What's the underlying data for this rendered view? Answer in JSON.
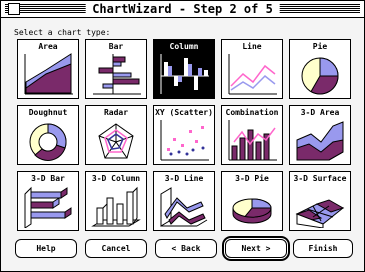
{
  "window": {
    "title": "ChartWizard - Step 2 of 5"
  },
  "prompt": "Select a chart type:",
  "chart_types": [
    {
      "label": "Area",
      "icon": "area-chart-icon",
      "selected": false
    },
    {
      "label": "Bar",
      "icon": "bar-chart-icon",
      "selected": false
    },
    {
      "label": "Column",
      "icon": "column-chart-icon",
      "selected": true
    },
    {
      "label": "Line",
      "icon": "line-chart-icon",
      "selected": false
    },
    {
      "label": "Pie",
      "icon": "pie-chart-icon",
      "selected": false
    },
    {
      "label": "Doughnut",
      "icon": "doughnut-chart-icon",
      "selected": false
    },
    {
      "label": "Radar",
      "icon": "radar-chart-icon",
      "selected": false
    },
    {
      "label": "XY (Scatter)",
      "icon": "scatter-chart-icon",
      "selected": false
    },
    {
      "label": "Combination",
      "icon": "combination-chart-icon",
      "selected": false
    },
    {
      "label": "3-D Area",
      "icon": "3d-area-chart-icon",
      "selected": false
    },
    {
      "label": "3-D Bar",
      "icon": "3d-bar-chart-icon",
      "selected": false
    },
    {
      "label": "3-D Column",
      "icon": "3d-column-chart-icon",
      "selected": false
    },
    {
      "label": "3-D Line",
      "icon": "3d-line-chart-icon",
      "selected": false
    },
    {
      "label": "3-D Pie",
      "icon": "3d-pie-chart-icon",
      "selected": false
    },
    {
      "label": "3-D Surface",
      "icon": "3d-surface-chart-icon",
      "selected": false
    }
  ],
  "buttons": {
    "help": "Help",
    "cancel": "Cancel",
    "back": "< Back",
    "next": "Next >",
    "finish": "Finish"
  },
  "colors": {
    "purple": "#7a2a6a",
    "lavender": "#9999ee",
    "pink": "#ff66cc",
    "cream": "#ffffcc",
    "dark_blue": "#333399"
  }
}
